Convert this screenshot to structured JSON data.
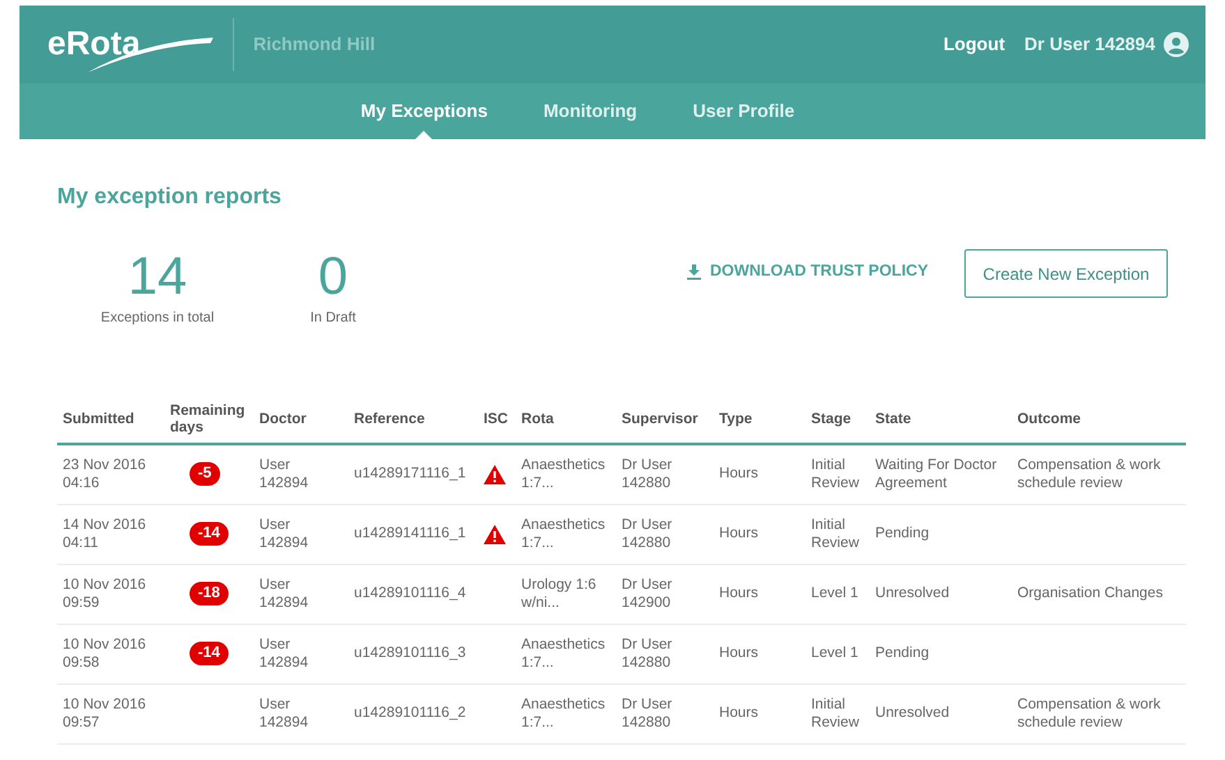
{
  "header": {
    "logo": "eRota",
    "site": "Richmond Hill",
    "logout": "Logout",
    "user": "Dr User 142894"
  },
  "nav": [
    {
      "label": "My Exceptions",
      "selected": true
    },
    {
      "label": "Monitoring",
      "selected": false
    },
    {
      "label": "User Profile",
      "selected": false
    }
  ],
  "page_title": "My exception reports",
  "stats": [
    {
      "value": "14",
      "label": "Exceptions in total"
    },
    {
      "value": "0",
      "label": "In Draft"
    }
  ],
  "download_link": "DOWNLOAD TRUST POLICY",
  "create_button": "Create New Exception",
  "table": {
    "columns": [
      "Submitted",
      "Remaining days",
      "Doctor",
      "Reference",
      "ISC",
      "Rota",
      "Supervisor",
      "Type",
      "Stage",
      "State",
      "Outcome"
    ],
    "rows": [
      {
        "submitted": "23 Nov 2016\n04:16",
        "remaining": "-5",
        "doctor": "User\n142894",
        "reference": "u14289171116_1",
        "isc_warning": true,
        "rota": "Anaesthetics\n1:7...",
        "supervisor": "Dr User\n142880",
        "type": "Hours",
        "stage": "Initial\nReview",
        "state": "Waiting For Doctor\nAgreement",
        "outcome": "Compensation & work\nschedule review"
      },
      {
        "submitted": "14 Nov 2016\n04:11",
        "remaining": "-14",
        "doctor": "User\n142894",
        "reference": "u14289141116_1",
        "isc_warning": true,
        "rota": "Anaesthetics\n1:7...",
        "supervisor": "Dr User\n142880",
        "type": "Hours",
        "stage": "Initial\nReview",
        "state": "Pending"
      },
      {
        "submitted": "10 Nov 2016\n09:59",
        "remaining": "-18",
        "doctor": "User\n142894",
        "reference": "u14289101116_4",
        "isc_warning": false,
        "rota": "Urology 1:6\nw/ni...",
        "supervisor": "Dr User\n142900",
        "type": "Hours",
        "stage": "Level 1",
        "state": "Unresolved",
        "outcome": "Organisation Changes"
      },
      {
        "submitted": "10 Nov 2016\n09:58",
        "remaining": "-14",
        "doctor": "User\n142894",
        "reference": "u14289101116_3",
        "isc_warning": false,
        "rota": "Anaesthetics\n1:7...",
        "supervisor": "Dr User\n142880",
        "type": "Hours",
        "stage": "Level 1",
        "state": "Pending"
      },
      {
        "submitted": "10 Nov 2016\n09:57",
        "doctor": "User\n142894",
        "reference": "u14289101116_2",
        "isc_warning": false,
        "rota": "Anaesthetics\n1:7...",
        "supervisor": "Dr User\n142880",
        "type": "Hours",
        "stage": "Initial\nReview",
        "state": "Unresolved",
        "outcome": "Compensation & work\nschedule review"
      }
    ]
  }
}
